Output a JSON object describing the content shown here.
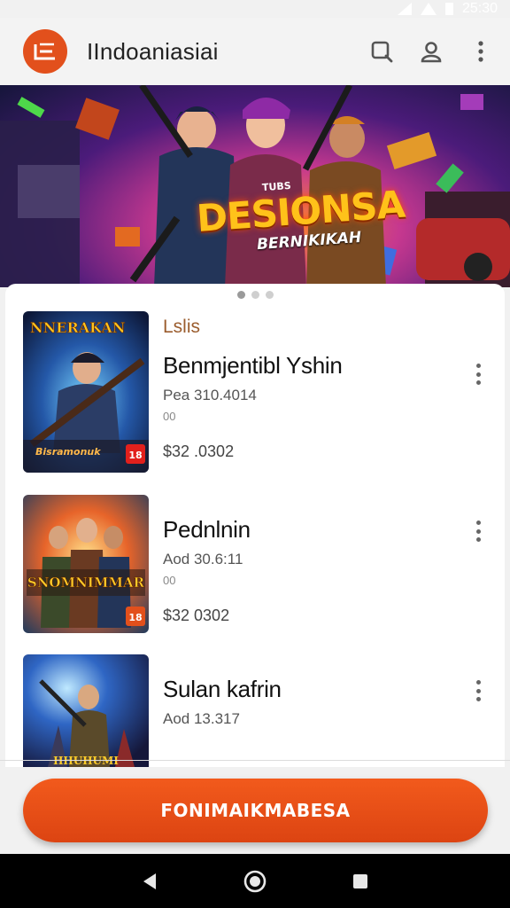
{
  "status_bar": {
    "time": "25:30"
  },
  "app_bar": {
    "title": "IIndoaniasiai"
  },
  "banner": {
    "kicker": "TUBS",
    "title": "DESIONSA",
    "subtitle": "BERNIKIKAH"
  },
  "pager": {
    "count": 3,
    "active": 0
  },
  "list": {
    "section_label": "Lslis",
    "items": [
      {
        "title": "Benmjentibl Yshin",
        "meta": "Pea 310.4014",
        "meta2": "00",
        "price": "$32 .0302",
        "thumb_title": "NNERAKAN",
        "thumb_caption": "Bisramonuk",
        "thumb_badge": "18"
      },
      {
        "title": "Pednlnin",
        "meta": "Aod 30.6:11",
        "meta2": "00",
        "price": "$32  0302",
        "thumb_title": "SNOMNIMMAR",
        "thumb_badge": "18"
      },
      {
        "title": "Sulan kafrin",
        "meta": "Aod 13.317",
        "thumb_title": "HHUHUMI"
      }
    ]
  },
  "cta": {
    "label": "FONIMAIKMABESA"
  },
  "colors": {
    "accent": "#e2501c",
    "section_label": "#9b5d2e"
  },
  "icons": [
    "app-logo-icon",
    "search-icon",
    "account-icon",
    "more-vert-icon",
    "back-icon",
    "home-icon",
    "recents-icon"
  ]
}
